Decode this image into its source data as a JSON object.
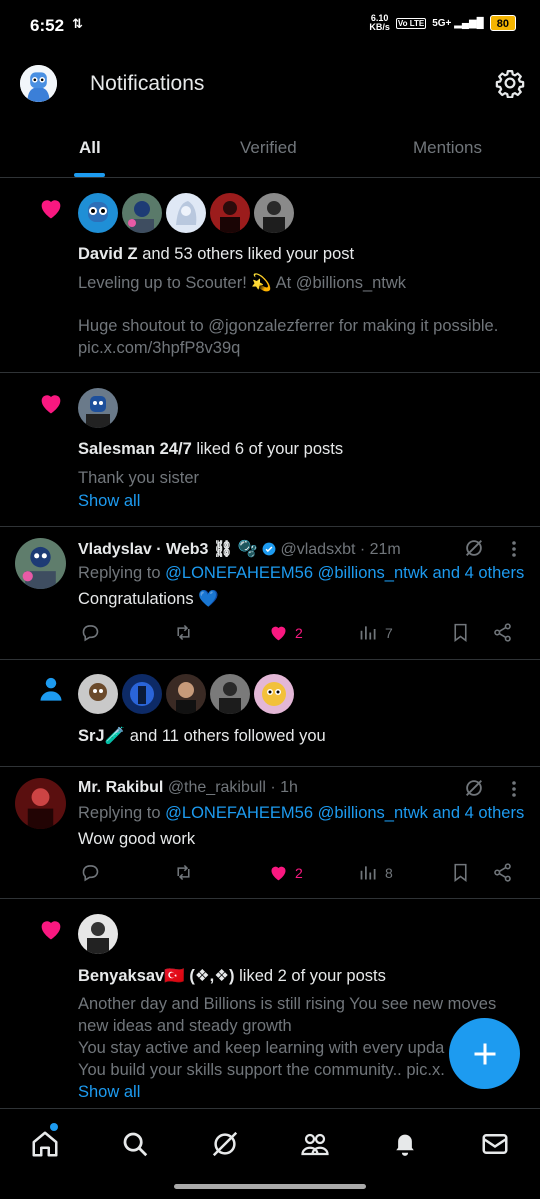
{
  "status_bar": {
    "time": "6:52",
    "net_speed_top": "6.10",
    "net_speed_bottom": "KB/s",
    "volte": "Vo LTE",
    "signal_label": "5G+",
    "battery": "80"
  },
  "header": {
    "title": "Notifications"
  },
  "tabs": [
    {
      "label": "All",
      "active": true
    },
    {
      "label": "Verified",
      "active": false
    },
    {
      "label": "Mentions",
      "active": false
    }
  ],
  "notifications": [
    {
      "type": "like",
      "actor": "David Z",
      "action": " and 53 others liked your post",
      "line1": "Leveling up to Scouter! 💫 At @billions_ntwk",
      "line2": "Huge shoutout to @jgonzalezferrer for making it possible.",
      "line3": "pic.x.com/3hpfP8v39q"
    },
    {
      "type": "like",
      "actor": "Salesman 24/7",
      "action": " liked 6 of your posts",
      "line1": "Thank you sister",
      "show_all": "Show all"
    },
    {
      "type": "reply",
      "name": "Vladyslav · Web3 ⛓ 🫧",
      "handle": "@vladsxbt · 21m",
      "replying_prefix": "Replying to ",
      "replying_to": "@LONEFAHEEM56 @billions_ntwk and 4 others",
      "body": "Congratulations 💙",
      "likes": "2",
      "views": "7"
    },
    {
      "type": "follow",
      "actor": "SrJ🧪",
      "action": " and 11 others followed you"
    },
    {
      "type": "reply",
      "name": "Mr. Rakibul",
      "handle": "@the_rakibull · 1h",
      "replying_prefix": "Replying to ",
      "replying_to": "@LONEFAHEEM56 @billions_ntwk and 4 others",
      "body": "Wow good work",
      "likes": "2",
      "views": "8"
    },
    {
      "type": "like",
      "actor": "Benyaksav🇹🇷 (❖,❖)",
      "action": " liked 2 of your posts",
      "line1": "Another day and Billions is still rising You see new moves",
      "line2": "new ideas and steady growth",
      "line3": "You stay active and keep learning with every upda",
      "line4": "You build your skills support the community.. pic.x.",
      "show_all": "Show all"
    }
  ],
  "colors": {
    "background": "#000000",
    "accent": "#1d9bf0",
    "like": "#f91880",
    "muted": "#71767b",
    "text": "#e7e9ea"
  },
  "icons": {
    "settings": "gear-icon",
    "like": "heart-icon",
    "follow": "person-icon",
    "reply": "comment-icon",
    "retweet": "repost-icon",
    "views": "bar-chart-icon",
    "bookmark": "bookmark-icon",
    "share": "share-icon",
    "grok": "grok-icon",
    "compose": "plus-icon",
    "nav": [
      "home-icon",
      "search-icon",
      "grok-icon",
      "communities-icon",
      "notifications-bell-icon",
      "messages-icon"
    ]
  }
}
